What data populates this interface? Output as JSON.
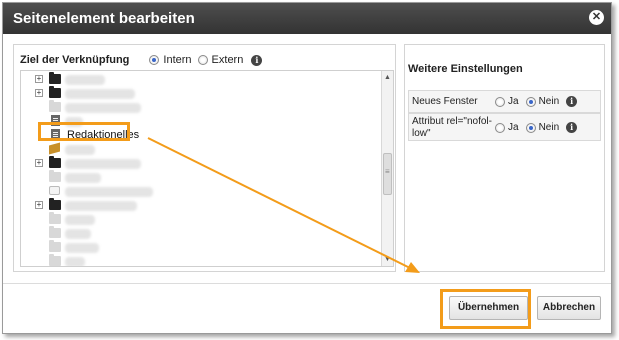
{
  "window": {
    "title": "Seitenelement bearbeiten",
    "close_icon": "close-icon"
  },
  "link_target": {
    "label": "Ziel der Verknüpfung",
    "option_intern": "Intern",
    "option_extern": "Extern",
    "selected": "Intern"
  },
  "tree": {
    "selected_node_label": "Redaktionelles"
  },
  "settings": {
    "title": "Weitere Einstellungen",
    "rows": [
      {
        "label": "Neues Fenster",
        "opt_ja": "Ja",
        "opt_nein": "Nein",
        "selected": "Nein"
      },
      {
        "label": "Attribut rel=\"nofol-low\"",
        "label_line1": "Attribut rel=\"nofol-",
        "label_line2": "low\"",
        "opt_ja": "Ja",
        "opt_nein": "Nein",
        "selected": "Nein"
      }
    ]
  },
  "buttons": {
    "submit": "Übernehmen",
    "cancel": "Abbrechen"
  },
  "colors": {
    "highlight": "#f39c1a",
    "titlebar": "#3d3d3d"
  }
}
